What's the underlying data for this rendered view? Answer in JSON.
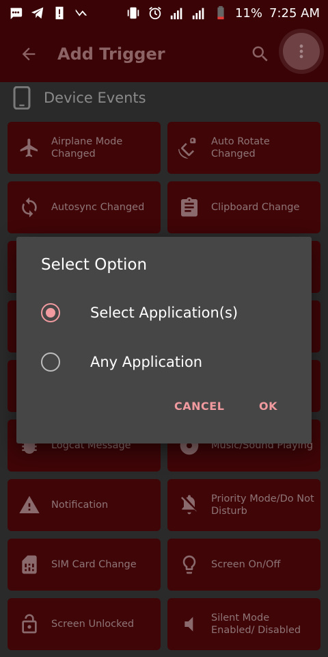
{
  "status_bar": {
    "battery": "11%",
    "time": "7:25 AM",
    "icons": [
      "message-icon",
      "telegram-icon",
      "alert-icon",
      "check-icon",
      "vibrate-icon",
      "alarm-icon",
      "signal-icon",
      "signal-icon",
      "battery-icon"
    ]
  },
  "app_bar": {
    "title": "Add Trigger",
    "icons": [
      "back-arrow-icon",
      "search-icon",
      "more-vert-icon"
    ]
  },
  "section": {
    "label": "Device Events",
    "icon": "phone-icon"
  },
  "tiles": [
    {
      "label": "Airplane Mode Changed",
      "icon": "airplane-icon"
    },
    {
      "label": "Auto Rotate Changed",
      "icon": "rotate-icon"
    },
    {
      "label": "Autosync Changed",
      "icon": "sync-icon"
    },
    {
      "label": "Clipboard Change",
      "icon": "clipboard-icon"
    },
    {
      "label": "Logcat Message",
      "icon": "bug-icon"
    },
    {
      "label": "Music/Sound Playing",
      "icon": "music-icon"
    },
    {
      "label": "Notification",
      "icon": "warning-icon"
    },
    {
      "label": "Priority Mode/Do Not Disturb",
      "icon": "bell-off-icon"
    },
    {
      "label": "SIM Card Change",
      "icon": "sim-card-icon"
    },
    {
      "label": "Screen On/Off",
      "icon": "lightbulb-icon"
    },
    {
      "label": "Screen Unlocked",
      "icon": "unlock-icon"
    },
    {
      "label": "Silent Mode Enabled/ Disabled",
      "icon": "speaker-icon"
    }
  ],
  "dialog": {
    "title": "Select Option",
    "options": [
      {
        "label": "Select Application(s)",
        "selected": true
      },
      {
        "label": "Any Application",
        "selected": false
      }
    ],
    "cancel_label": "CANCEL",
    "ok_label": "OK"
  },
  "colors": {
    "accent": "#f19a9f",
    "tile_bg": "#3f0507",
    "appbar_bg": "#3a0406",
    "dialog_bg": "#464646"
  }
}
